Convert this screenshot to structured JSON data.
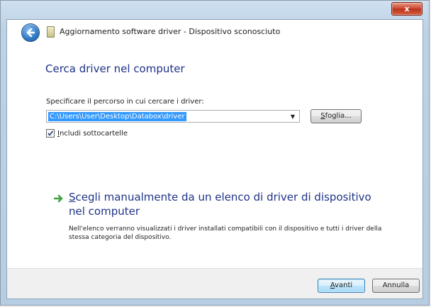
{
  "window": {
    "title": "Aggiornamento software driver - Dispositivo sconosciuto",
    "close_label": "x"
  },
  "page": {
    "heading": "Cerca driver nel computer",
    "path_label": "Specificare il percorso in cui cercare i driver:",
    "path_value": "C:\\Users\\User\\Desktop\\Databox\\driver",
    "browse_button": {
      "mnemonic": "S",
      "rest": "foglia..."
    },
    "include_subfolders": {
      "mnemonic": "I",
      "rest": "ncludi sottocartelle",
      "checked": true
    }
  },
  "choice": {
    "title_mnemonic": "S",
    "title_rest": "cegli manualmente da un elenco di driver di dispositivo nel computer",
    "description": "Nell'elenco verranno visualizzati i driver installati compatibili con il dispositivo e tutti i driver della stessa categoria del dispositivo."
  },
  "footer": {
    "next_button": {
      "mnemonic": "A",
      "rest": "vanti"
    },
    "cancel_button": "Annulla"
  },
  "colors": {
    "heading": "#1e3287",
    "arrow_green": "#3aa33a",
    "selection": "#3399ff"
  }
}
